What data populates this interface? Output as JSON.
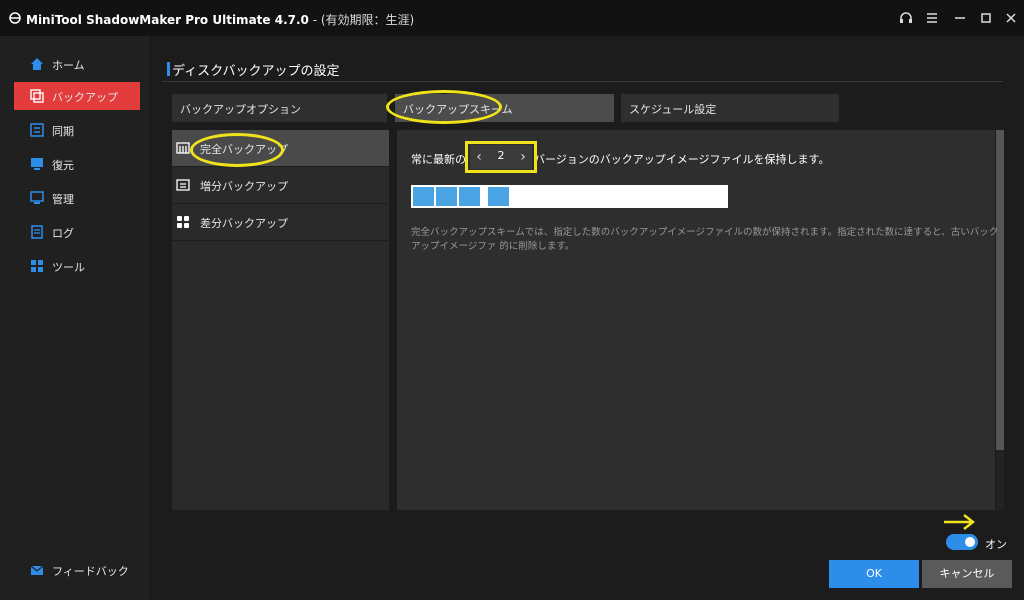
{
  "window": {
    "app_title": "MiniTool ShadowMaker Pro Ultimate 4.7.0",
    "license": " - (有効期限：生涯)",
    "controls": [
      "headset-icon",
      "menu-icon",
      "minimize-icon",
      "maximize-icon",
      "close-icon"
    ]
  },
  "sidebar": {
    "items": [
      {
        "label": "ホーム",
        "icon": "home-icon"
      },
      {
        "label": "バックアップ",
        "icon": "backup-icon"
      },
      {
        "label": "同期",
        "icon": "sync-icon"
      },
      {
        "label": "復元",
        "icon": "restore-icon"
      },
      {
        "label": "管理",
        "icon": "manage-icon"
      },
      {
        "label": "ログ",
        "icon": "log-icon"
      },
      {
        "label": "ツール",
        "icon": "tools-icon"
      }
    ],
    "feedback": "フィードバック"
  },
  "page": {
    "title": "ディスクバックアップの設定",
    "tabs": [
      "バックアップオプション",
      "バックアップスキーム",
      "スケジュール設定"
    ],
    "schemes": [
      "完全バックアップ",
      "増分バックアップ",
      "差分バックアップ"
    ],
    "keep_prefix": "常に最新の",
    "keep_value": "2",
    "keep_suffix": "バージョンのバックアップイメージファイルを保持します。",
    "description": "完全バックアップスキームでは、指定した数のバックアップイメージファイルの数が保持されます。指定された数に達すると、古いバックアップイメージファ 的に削除します。",
    "toggle_label": "オン",
    "ok_label": "OK",
    "cancel_label": "キャンセル"
  },
  "colors": {
    "accent_blue": "#2d8ee9",
    "active_red": "#e23c3c",
    "highlight_yellow": "#f1e31a"
  }
}
